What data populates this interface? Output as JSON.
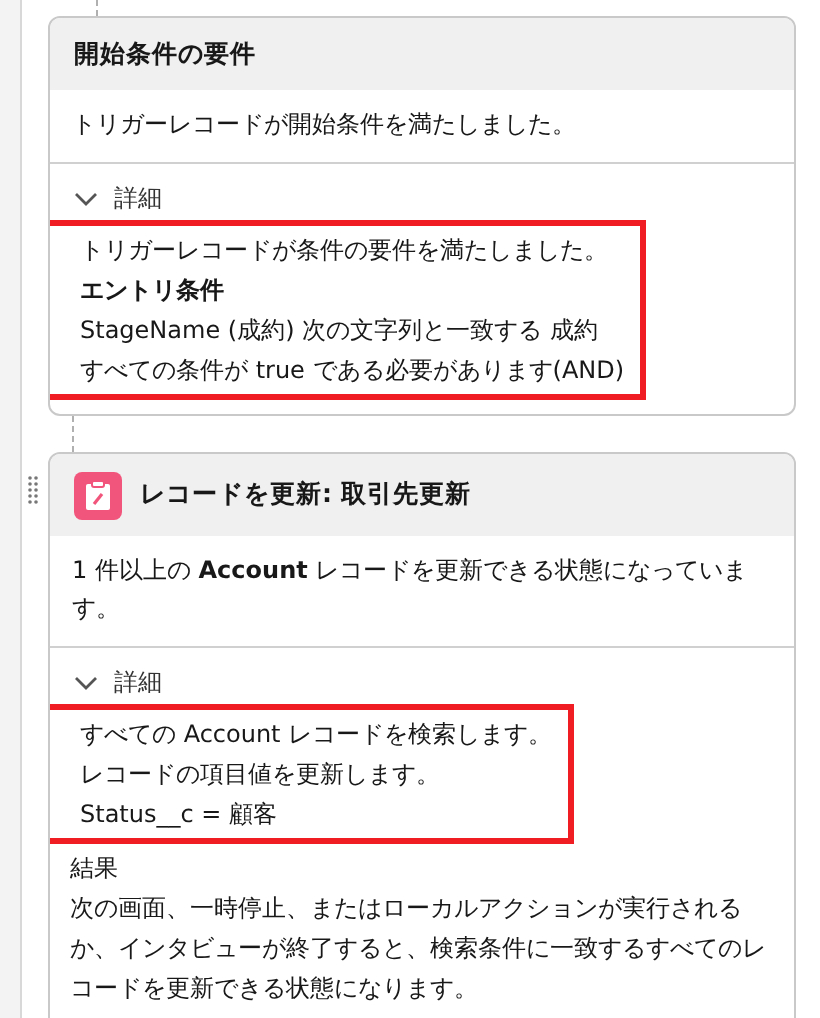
{
  "cards": [
    {
      "title": "開始条件の要件",
      "kind": "requirement",
      "description": "トリガーレコードが開始条件を満たしました。",
      "details": {
        "label": "詳細",
        "expanded": true,
        "highlighted": true,
        "lines": [
          {
            "text": "トリガーレコードが条件の要件を満たしました。",
            "kind": "plain"
          },
          {
            "text": "エントリ条件",
            "kind": "heading"
          },
          {
            "text": "StageName (成約) 次の文字列と一致する 成約",
            "kind": "plain"
          },
          {
            "text": "すべての条件が true である必要があります(AND)",
            "kind": "plain"
          }
        ]
      }
    },
    {
      "title": "レコードを更新: 取引先更新",
      "kind": "update",
      "description": "1 件以上の **Account** レコードを更新できる状態になっています。",
      "details": {
        "label": "詳細",
        "expanded": true,
        "highlighted": true,
        "lines": [
          {
            "text": "すべての Account レコードを検索します。",
            "kind": "plain"
          },
          {
            "text": "レコードの項目値を更新します。",
            "kind": "plain"
          },
          {
            "text": "Status__c = 顧客",
            "kind": "plain"
          }
        ]
      },
      "result": {
        "label": "結果",
        "text": "次の画面、一時停止、またはローカルアクションが実行されるか、インタビューが終了すると、検索条件に一致するすべてのレコードを更新できる状態になります。"
      }
    }
  ]
}
